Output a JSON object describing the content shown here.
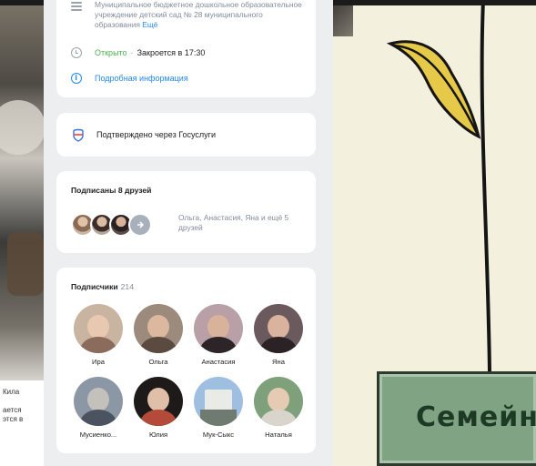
{
  "organization": {
    "text": "Муниципальное бюджетное дошкольное образовательное учреждение детский сад № 28 муниципального образования",
    "more_link": "Ещё",
    "status_open": "Открыто",
    "status_closes": "Закроется в 17:30",
    "details_link": "Подробная информация"
  },
  "gosuslugi": {
    "label": "Подтверждено через Госуслуги"
  },
  "friends": {
    "title": "Подписаны 8 друзей",
    "names_text": "Ольга, Анастасия, Яна и ещё 5 друзей",
    "more_icon": "arrow-right-icon"
  },
  "followers": {
    "title": "Подписчики",
    "count": "214",
    "items": [
      {
        "name": "Ира"
      },
      {
        "name": "Ольга"
      },
      {
        "name": "Анастасия"
      },
      {
        "name": "Яна"
      },
      {
        "name": "Мусиенко..."
      },
      {
        "name": "Юлия"
      },
      {
        "name": "Мук-Сыкс"
      },
      {
        "name": "Наталья"
      }
    ]
  },
  "background": {
    "board_title": "Семейн",
    "left_caption_lines": [
      "Кила",
      "",
      "ается",
      "этся в"
    ]
  },
  "colors": {
    "accent_blue": "#2688eb",
    "open_green": "#4bb34b",
    "secondary_text": "#818c99",
    "feed_bg": "#edeef0",
    "board_green": "#7fa383"
  }
}
